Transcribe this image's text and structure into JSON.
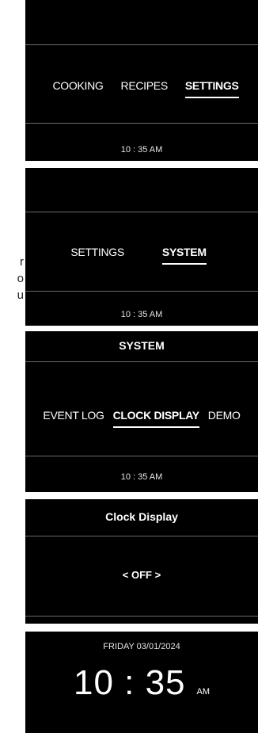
{
  "side_text": [
    "r",
    "o",
    "u"
  ],
  "screen1": {
    "tabs": [
      {
        "label": "COOKING",
        "active": false
      },
      {
        "label": "RECIPES",
        "active": false
      },
      {
        "label": "SETTINGS",
        "active": true
      }
    ],
    "time": "10 : 35 AM"
  },
  "screen2": {
    "tabs": [
      {
        "label": "SETTINGS",
        "active": false
      },
      {
        "label": "SYSTEM",
        "active": true
      }
    ],
    "time": "10 : 35 AM"
  },
  "screen3": {
    "title": "SYSTEM",
    "tabs": [
      {
        "label": "EVENT LOG",
        "active": false
      },
      {
        "label": "CLOCK DISPLAY",
        "active": true
      },
      {
        "label": "DEMO",
        "active": false
      }
    ],
    "time": "10 : 35 AM"
  },
  "screen4": {
    "title": "Clock Display",
    "option": "< OFF >"
  },
  "screen5": {
    "date": "FRIDAY 03/01/2024",
    "time": "10 : 35",
    "ampm": "AM"
  }
}
